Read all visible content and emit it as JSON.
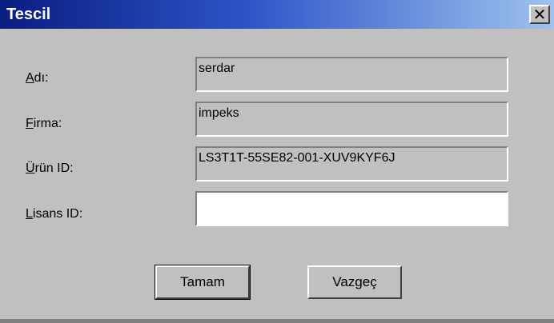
{
  "window": {
    "title": "Tescil",
    "close_symbol": "✕"
  },
  "form": {
    "fields": [
      {
        "label_mnemonic": "A",
        "label_rest": "dı:",
        "value": "serdar"
      },
      {
        "label_mnemonic": "F",
        "label_rest": "irma:",
        "value": "impeks"
      },
      {
        "label_mnemonic": "Ü",
        "label_rest": "rün ID:",
        "value": "LS3T1T-55SE82-001-XUV9KYF6J"
      },
      {
        "label_mnemonic": "L",
        "label_rest": "isans ID:",
        "value": ""
      }
    ]
  },
  "buttons": {
    "ok_label": "Tamam",
    "cancel_label": "Vazgeç"
  },
  "colors": {
    "face": "#c0c0c0",
    "title_start": "#0a1d80",
    "title_end": "#9fc3ee"
  }
}
